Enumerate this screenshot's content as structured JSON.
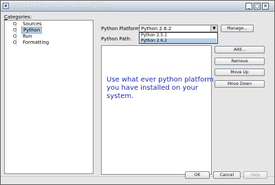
{
  "window": {
    "title": "Project Properties - LearnPython",
    "controls": {
      "minimize": "_",
      "maximize": "□",
      "close": "✕"
    }
  },
  "categories": {
    "label_mnemonic": "C",
    "label_rest": "ategories:",
    "items": [
      {
        "label": "Sources",
        "selected": false
      },
      {
        "label": "Python",
        "selected": true
      },
      {
        "label": "Run",
        "selected": false
      },
      {
        "label": "Formatting",
        "selected": false
      }
    ]
  },
  "platform": {
    "label": "Python Platform:",
    "selected": "Python 2.6.2",
    "options": [
      "Python 2.5.1",
      "Python 2.6.2"
    ],
    "manage_label": "Manage..."
  },
  "path": {
    "label": "Python Path:",
    "buttons": [
      "Add...",
      "Remove",
      "Move Up",
      "Move Down"
    ]
  },
  "annotation": "Use what ever python platform you have installed on your system.",
  "footer": {
    "ok_label": "OK",
    "cancel_label": "Cancel",
    "help_label": "Help"
  }
}
